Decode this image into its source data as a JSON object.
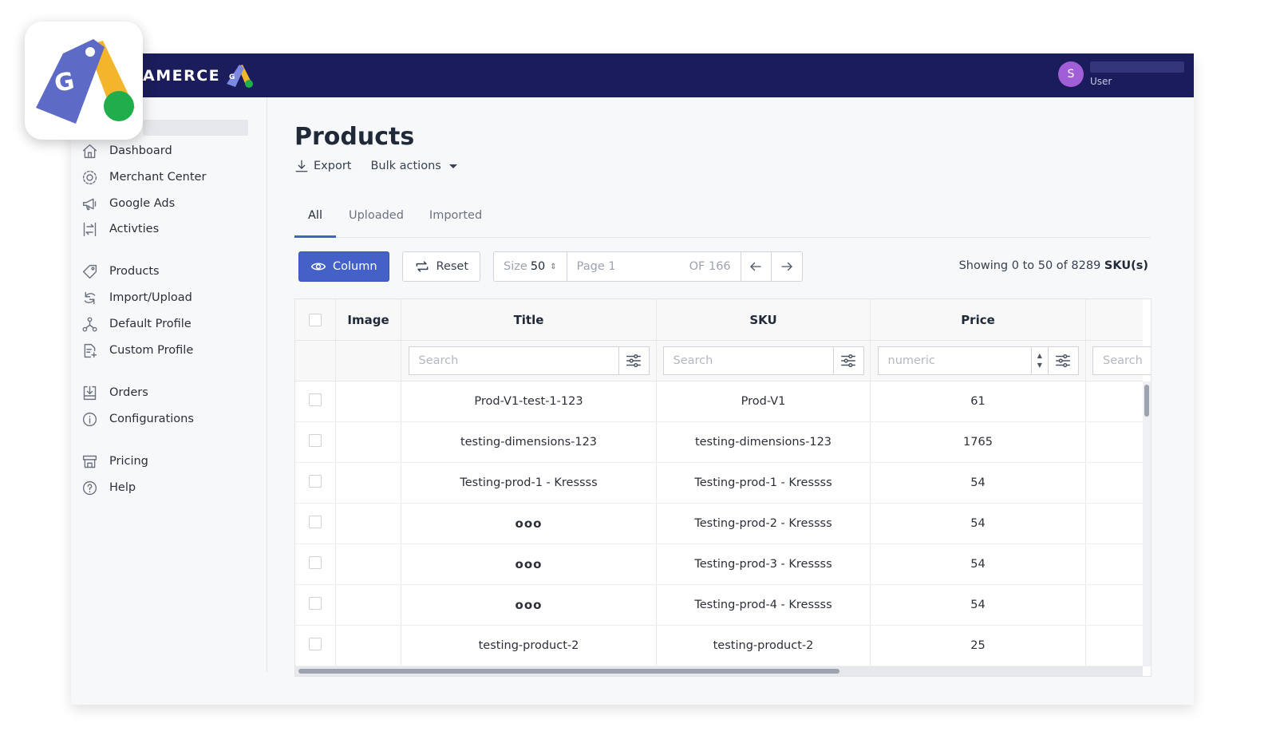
{
  "brand": {
    "name": "AMERCE"
  },
  "user": {
    "initial": "S",
    "role": "User"
  },
  "sidebar": {
    "items": [
      {
        "label": "Dashboard",
        "icon": "home-icon"
      },
      {
        "label": "Merchant Center",
        "icon": "target-icon"
      },
      {
        "label": "Google Ads",
        "icon": "megaphone-icon"
      },
      {
        "label": "Activties",
        "icon": "swap-icon"
      },
      {
        "label": "Products",
        "icon": "tag-icon"
      },
      {
        "label": "Import/Upload",
        "icon": "sync-icon"
      },
      {
        "label": "Default Profile",
        "icon": "network-icon"
      },
      {
        "label": "Custom Profile",
        "icon": "document-plus-icon"
      },
      {
        "label": "Orders",
        "icon": "inbox-download-icon"
      },
      {
        "label": "Configurations",
        "icon": "info-icon"
      },
      {
        "label": "Pricing",
        "icon": "store-icon"
      },
      {
        "label": "Help",
        "icon": "help-icon"
      }
    ]
  },
  "page": {
    "title": "Products",
    "export_label": "Export",
    "bulk_label": "Bulk actions",
    "tabs": [
      {
        "label": "All",
        "active": true
      },
      {
        "label": "Uploaded",
        "active": false
      },
      {
        "label": "Imported",
        "active": false
      }
    ]
  },
  "toolbar": {
    "column_label": "Column",
    "reset_label": "Reset",
    "size_label": "Size",
    "size_value": "50",
    "page_placeholder": "Page 1",
    "page_of": "OF 166",
    "showing_text": "Showing 0 to 50 of 8289",
    "showing_unit": "SKU(s)"
  },
  "grid": {
    "columns": {
      "image": "Image",
      "title": "Title",
      "sku": "SKU",
      "price": "Price"
    },
    "filters": {
      "title": "Search",
      "sku": "Search",
      "price": "numeric",
      "more": "Search"
    },
    "rows": [
      {
        "title": "Prod-V1-test-1-123",
        "sku": "Prod-V1",
        "price": "61"
      },
      {
        "title": "testing-dimensions-123",
        "sku": "testing-dimensions-123",
        "price": "1765"
      },
      {
        "title": "Testing-prod-1 - Kressss",
        "sku": "Testing-prod-1 - Kressss",
        "price": "54"
      },
      {
        "title": "ooo",
        "sku": "Testing-prod-2 - Kressss",
        "price": "54"
      },
      {
        "title": "ooo",
        "sku": "Testing-prod-3 - Kressss",
        "price": "54"
      },
      {
        "title": "ooo",
        "sku": "Testing-prod-4 - Kressss",
        "price": "54"
      },
      {
        "title": "testing-product-2",
        "sku": "testing-product-2",
        "price": "25"
      }
    ]
  },
  "colors": {
    "navbar": "#1b1c5c",
    "accent": "#4361c7",
    "avatar": "#a05fd6"
  }
}
